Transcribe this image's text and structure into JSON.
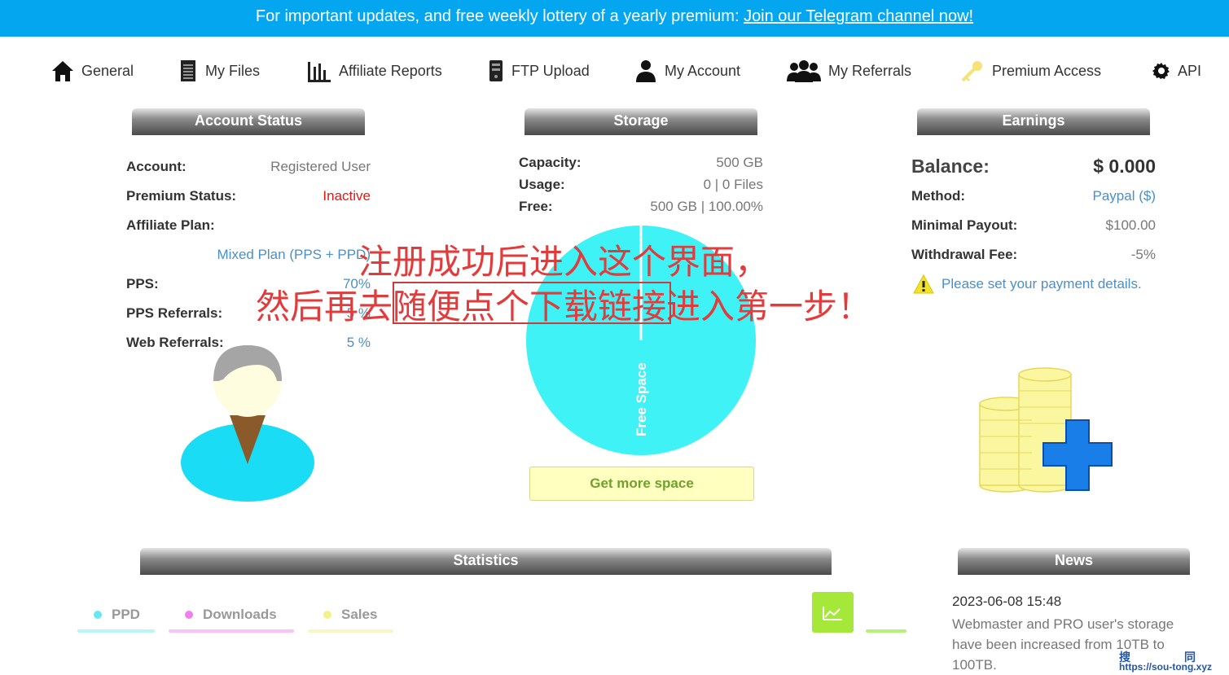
{
  "banner": {
    "text": "For important updates, and free weekly lottery of a yearly premium: ",
    "link": "Join our Telegram channel now!"
  },
  "nav": [
    {
      "label": "General",
      "icon": "home-icon"
    },
    {
      "label": "My Files",
      "icon": "files-icon"
    },
    {
      "label": "Affiliate Reports",
      "icon": "bar-chart-icon"
    },
    {
      "label": "FTP Upload",
      "icon": "server-icon"
    },
    {
      "label": "My Account",
      "icon": "user-icon"
    },
    {
      "label": "My Referrals",
      "icon": "users-icon"
    },
    {
      "label": "Premium Access",
      "icon": "key-icon"
    },
    {
      "label": "API",
      "icon": "gear-icon"
    }
  ],
  "account": {
    "title": "Account Status",
    "rows": [
      {
        "k": "Account:",
        "v": "Registered User"
      },
      {
        "k": "Premium Status:",
        "v": "Inactive"
      },
      {
        "k": "Affiliate Plan:",
        "v": ""
      },
      {
        "k": "",
        "v": "Mixed Plan (PPS + PPD)"
      },
      {
        "k": "PPS:",
        "v": "70%"
      },
      {
        "k": "PPS Referrals:",
        "v": "5 %"
      },
      {
        "k": "Web Referrals:",
        "v": "5 %"
      }
    ]
  },
  "storage": {
    "title": "Storage",
    "rows": [
      {
        "k": "Capacity:",
        "v": "500 GB"
      },
      {
        "k": "Usage:",
        "v": "0 | 0 Files"
      },
      {
        "k": "Free:",
        "v": "500 GB | 100.00%"
      }
    ],
    "pie_label": "Free Space",
    "pie_color": "#3ef2f6",
    "button": "Get more space"
  },
  "earnings": {
    "title": "Earnings",
    "balance_label": "Balance:",
    "balance_value": "$ 0.000",
    "rows": [
      {
        "k": "Method:",
        "v": "Paypal ($)"
      },
      {
        "k": "Minimal Payout:",
        "v": "$100.00"
      },
      {
        "k": "Withdrawal Fee:",
        "v": "-5%"
      }
    ],
    "warning": "Please set your payment details."
  },
  "overlay": {
    "line1": "注册成功后进入这个界面，",
    "line2": "然后再去随便点个下载链接进入第一步！"
  },
  "statistics": {
    "title": "Statistics",
    "legend": [
      {
        "label": "PPD",
        "color": "#66e8f0"
      },
      {
        "label": "Downloads",
        "color": "#f07ef0"
      },
      {
        "label": "Sales",
        "color": "#f4f08a"
      }
    ]
  },
  "news": {
    "title": "News",
    "date": "2023-06-08 15:48",
    "text": "Webmaster and PRO user's storage have been increased from 10TB to 100TB."
  },
  "watermark": {
    "brand1": "搜",
    "brand2": "同",
    "url": "https://sou-tong.xyz"
  }
}
